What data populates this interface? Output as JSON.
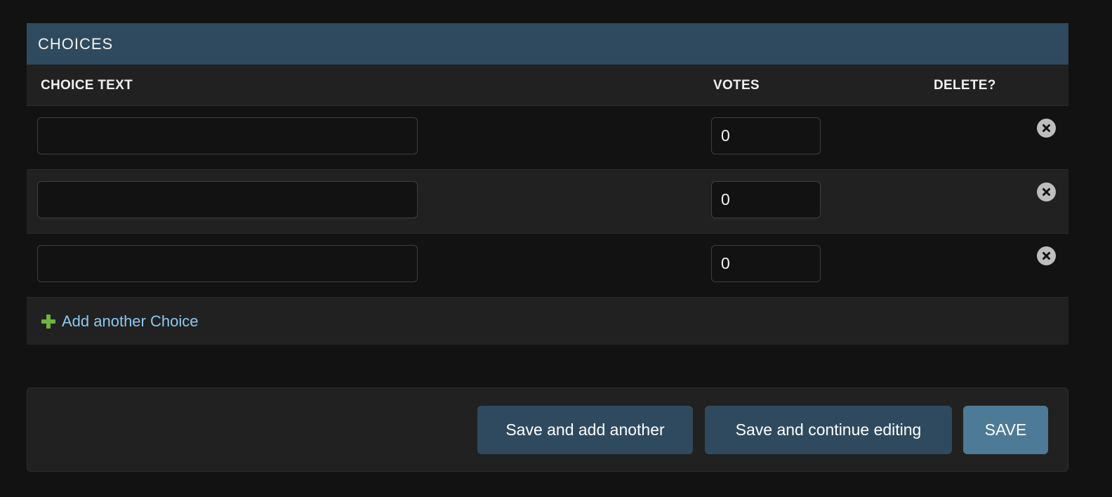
{
  "section": {
    "title": "CHOICES"
  },
  "columns": {
    "choice_text": "CHOICE TEXT",
    "votes": "VOTES",
    "delete": "DELETE?"
  },
  "rows": [
    {
      "choice_text": "",
      "votes": "0"
    },
    {
      "choice_text": "",
      "votes": "0"
    },
    {
      "choice_text": "",
      "votes": "0"
    }
  ],
  "add_link": {
    "label": "Add another Choice",
    "icon": "plus-icon"
  },
  "buttons": {
    "save_add_another": "Save and add another",
    "save_continue": "Save and continue editing",
    "save": "SAVE"
  },
  "colors": {
    "header_bg": "#2f4a5e",
    "save_bg": "#4d7a96",
    "link": "#8dc9ef",
    "add_icon": "#6fb33a"
  }
}
